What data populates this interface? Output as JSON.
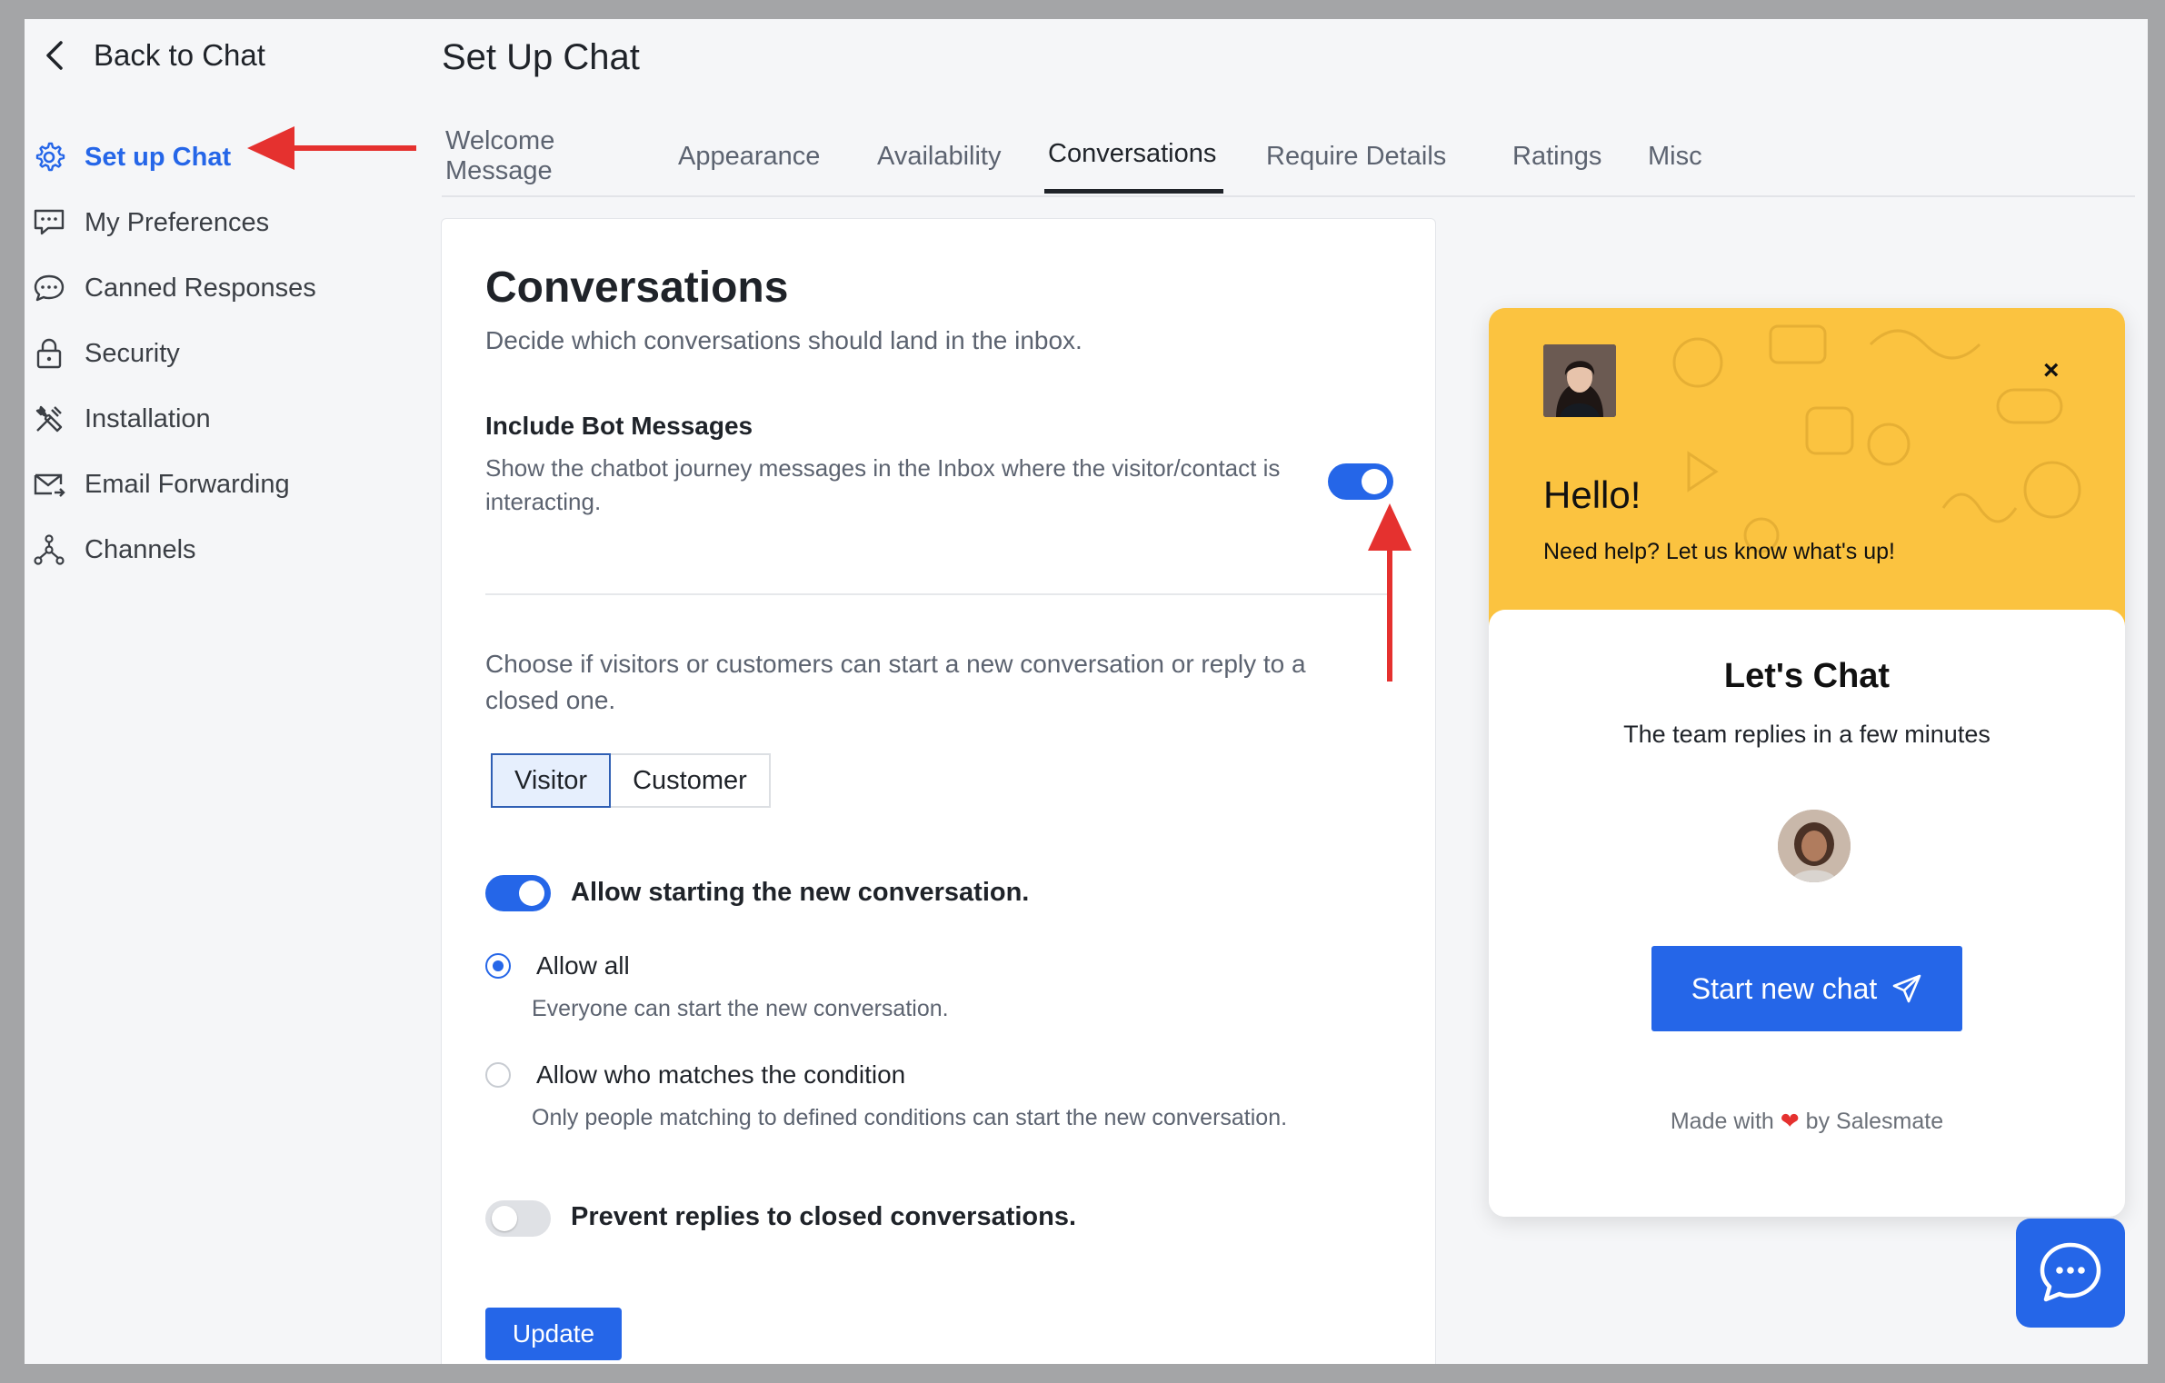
{
  "nav": {
    "back_label": "Back to Chat",
    "items": [
      {
        "label": "Set up Chat",
        "icon": "gear-icon",
        "active": true
      },
      {
        "label": "My Preferences",
        "icon": "preferences-chat-icon"
      },
      {
        "label": "Canned Responses",
        "icon": "speech-bubble-icon"
      },
      {
        "label": "Security",
        "icon": "lock-icon"
      },
      {
        "label": "Installation",
        "icon": "tools-icon"
      },
      {
        "label": "Email Forwarding",
        "icon": "email-forward-icon"
      },
      {
        "label": "Channels",
        "icon": "hierarchy-icon"
      }
    ]
  },
  "header": {
    "title": "Set Up Chat",
    "tabs": [
      {
        "label": "Welcome Message"
      },
      {
        "label": "Appearance"
      },
      {
        "label": "Availability"
      },
      {
        "label": "Conversations",
        "active": true
      },
      {
        "label": "Require Details"
      },
      {
        "label": "Ratings"
      },
      {
        "label": "Misc"
      }
    ]
  },
  "card": {
    "title": "Conversations",
    "subtitle": "Decide which conversations should land in the inbox.",
    "bot_messages": {
      "title": "Include Bot Messages",
      "description": "Show the chatbot journey messages in the Inbox where the visitor/contact is interacting.",
      "enabled": true
    },
    "choose_text": "Choose if visitors or customers can start a new conversation or reply to a closed one.",
    "segments": [
      {
        "label": "Visitor",
        "active": true
      },
      {
        "label": "Customer"
      }
    ],
    "allow_new": {
      "label": "Allow starting the new conversation.",
      "enabled": true
    },
    "options": [
      {
        "title": "Allow all",
        "desc": "Everyone can start the new conversation.",
        "checked": true
      },
      {
        "title": "Allow who matches the condition",
        "desc": "Only people matching to defined conditions can start the new conversation.",
        "checked": false
      }
    ],
    "prevent_replies": {
      "label": "Prevent replies to closed conversations.",
      "enabled": false
    },
    "update_label": "Update"
  },
  "widget": {
    "close": "×",
    "hello": "Hello!",
    "help": "Need help? Let us know what's up!",
    "lets_chat": "Let's Chat",
    "team_replies": "The team replies in a few minutes",
    "start_label": "Start new chat",
    "made_with": "Made with",
    "by": "by Salesmate",
    "header_color": "#fbc340",
    "accent": "#2566e8"
  },
  "colors": {
    "primary": "#2566e8",
    "annotation_arrow": "#e5312f"
  }
}
